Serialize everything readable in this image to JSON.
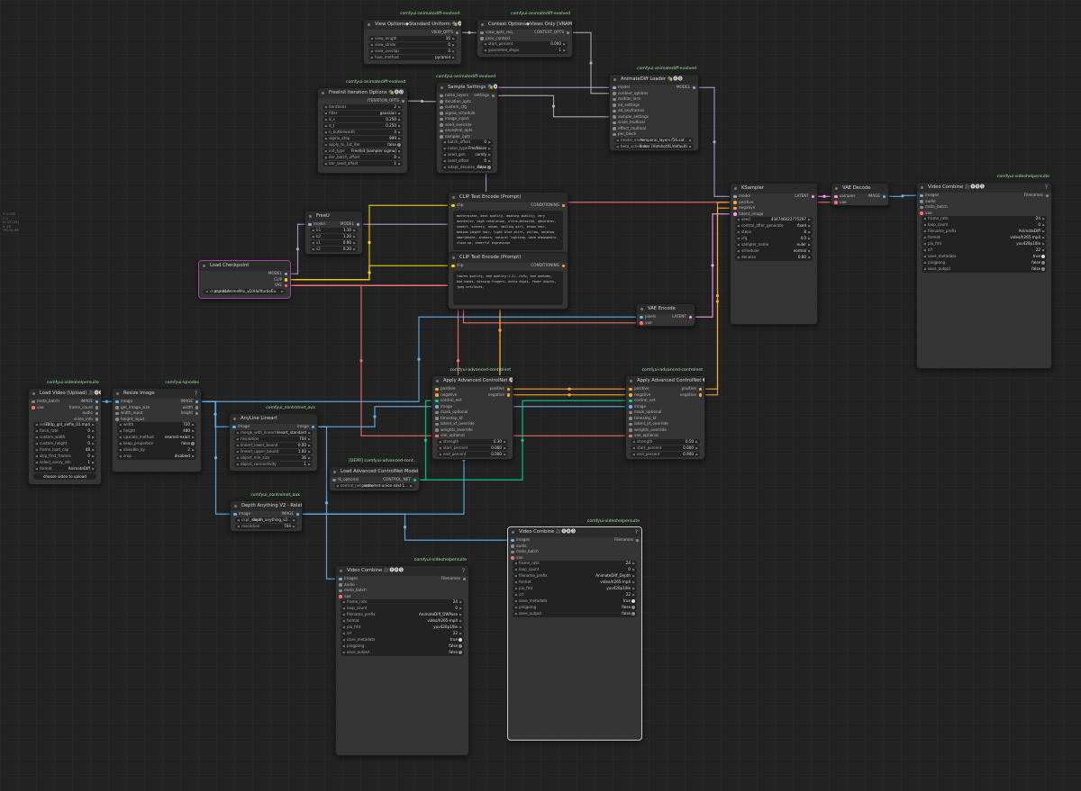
{
  "side_info": [
    "T: 0.000",
    "I: 0",
    "N: 23 [23]",
    "V: 48",
    "FPS:91.88"
  ],
  "nodes": {
    "view_options": {
      "badge": "comfyui-animatediff-evolved",
      "title": "View Options◆Standard Uniform 🎭🅐🅓",
      "outputs": [
        "VIEW_OPTS"
      ],
      "widgets": [
        {
          "label": "view_length",
          "value": "16"
        },
        {
          "label": "view_stride",
          "value": "0"
        },
        {
          "label": "view_overlap",
          "value": "4"
        },
        {
          "label": "fuse_method",
          "value": "pyramid"
        }
      ]
    },
    "context_options": {
      "badge": "comfyui-animatediff-evolved",
      "title": "Context Options◆Views Only [VRAM⇈] 🎭🅐🅓",
      "inputs": [
        "view_opts_req",
        "prev_context"
      ],
      "outputs": [
        "CONTEXT_OPTS"
      ],
      "widgets": [
        {
          "label": "start_percent",
          "value": "0.000"
        },
        {
          "label": "guarantee_steps",
          "value": "1"
        }
      ]
    },
    "freeinit": {
      "badge": "comfyui-animatediff-evolved",
      "title": "FreeInit Iteration Options 🎭🅐🅓",
      "outputs": [
        "ITERATION_OPTS"
      ],
      "widgets": [
        {
          "label": "iterations",
          "value": "2"
        },
        {
          "label": "filter",
          "value": "gaussian"
        },
        {
          "label": "d_s",
          "value": "0.250"
        },
        {
          "label": "d_t",
          "value": "0.250"
        },
        {
          "label": "n_butterworth",
          "value": "4"
        },
        {
          "label": "sigma_step",
          "value": "999"
        },
        {
          "label": "apply_to_1st_iter",
          "value": "false"
        },
        {
          "label": "init_type",
          "value": "FreeInit [sampler sigma]"
        },
        {
          "label": "iter_batch_offset",
          "value": "0"
        },
        {
          "label": "iter_seed_offset",
          "value": "1"
        }
      ]
    },
    "sample_settings": {
      "badge": "comfyui-animatediff-evolved",
      "title": "Sample Settings 🎭🅐🅓",
      "inputs": [
        "noise_layers",
        "iteration_opts",
        "custom_cfg",
        "sigma_schedule",
        "image_inject",
        "seed_override",
        "ancestral_opts",
        "sampler_opts"
      ],
      "outputs": [
        "settings"
      ],
      "widgets": [
        {
          "label": "batch_offset",
          "value": "0"
        },
        {
          "label": "noise_type",
          "value": "FreeNoise"
        },
        {
          "label": "seed_gen",
          "value": "comfy"
        },
        {
          "label": "seed_offset",
          "value": "0"
        },
        {
          "label": "adapt_denoise_steps",
          "value": "false"
        }
      ]
    },
    "ad_loader": {
      "badge": "comfyui-animatediff-evolved",
      "title": "AnimateDiff Loader 🎭🅐🅓",
      "inputs": [
        "model",
        "context_options",
        "motion_lora",
        "ad_settings",
        "ad_keyframes",
        "sample_settings",
        "scale_multival",
        "effect_multival",
        "per_block"
      ],
      "outputs": [
        "MODEL"
      ],
      "widgets": [
        {
          "label": "model_name",
          "value": "temporal_layers.f16.saf..."
        },
        {
          "label": "beta_schedule",
          "value": "linear (HotshotXL/default)"
        }
      ]
    },
    "freeu": {
      "title": "FreeU",
      "inputs": [
        "model"
      ],
      "outputs": [
        "MODEL"
      ],
      "widgets": [
        {
          "label": "b1",
          "value": "1.10"
        },
        {
          "label": "b2",
          "value": "1.20"
        },
        {
          "label": "s1",
          "value": "0.90"
        },
        {
          "label": "s2",
          "value": "0.20"
        }
      ]
    },
    "clip_pos": {
      "title": "CLIP Text Encode (Prompt)",
      "inputs": [
        "clip"
      ],
      "outputs": [
        "CONDITIONING"
      ],
      "text": "masterpiece, best quality, amazing quality, very aesthetic, high resolution, ultra-detailed, absurdres, newest, scenery, anime, smiling girl, brown hair, medium-length hair, light blue shirt, yellow, holding smartphone, indoors, natural lighting, warm atmosphere, close-up, cheerful expression"
    },
    "clip_neg": {
      "title": "CLIP Text Encode (Prompt)",
      "inputs": [
        "clip"
      ],
      "outputs": [
        "CONDITIONING"
      ],
      "text": "lowres quality, bad quality:1.2), nsfw, bad anatomy, bad hands, missing fingers, extra digit, fewer digits, jpeg artifacts,"
    },
    "checkpoint": {
      "title": "Load Checkpoint",
      "outputs": [
        "MODEL",
        "CLIP",
        "VAE"
      ],
      "widgets": [
        {
          "label": "ckpt_name",
          "value": "aamXLAnimeMix_v10HalfturboEu..."
        }
      ]
    },
    "ksampler": {
      "title": "KSampler",
      "inputs": [
        "model",
        "positive",
        "negative",
        "latent_image"
      ],
      "outputs": [
        "LATENT"
      ],
      "widgets": [
        {
          "label": "seed",
          "value": "434746022775297"
        },
        {
          "label": "control_after_generate",
          "value": "fixed"
        },
        {
          "label": "steps",
          "value": "8"
        },
        {
          "label": "cfg",
          "value": "4.0"
        },
        {
          "label": "sampler_name",
          "value": "euler"
        },
        {
          "label": "scheduler",
          "value": "normal"
        },
        {
          "label": "denoise",
          "value": "0.80"
        }
      ]
    },
    "vae_decode": {
      "title": "VAE Decode",
      "inputs": [
        "samples",
        "vae"
      ],
      "outputs": [
        "IMAGE"
      ]
    },
    "vc_main": {
      "badge": "comfyui-videohelpersuite",
      "title": "Video Combine 🎥🅥🅗🅢",
      "inputs": [
        "images",
        "audio",
        "meta_batch",
        "vae"
      ],
      "outputs": [
        "Filenames"
      ],
      "widgets": [
        {
          "label": "frame_rate",
          "value": "24"
        },
        {
          "label": "loop_count",
          "value": "0"
        },
        {
          "label": "filename_prefix",
          "value": "AnimateDiff"
        },
        {
          "label": "format",
          "value": "video/h265-mp4"
        },
        {
          "label": "pix_fmt",
          "value": "yuv420p10le"
        },
        {
          "label": "crf",
          "value": "22"
        },
        {
          "label": "save_metadata",
          "value": "true"
        },
        {
          "label": "pingpong",
          "value": "false"
        },
        {
          "label": "save_output",
          "value": "false"
        }
      ]
    },
    "vae_encode": {
      "title": "VAE Encode",
      "inputs": [
        "pixels",
        "vae"
      ],
      "outputs": [
        "LATENT"
      ]
    },
    "load_video": {
      "badge": "comfyui-videohelpersuite",
      "title": "Load Video (Upload) 🎥🅥🅗🅢",
      "inputs": [
        "meta_batch",
        "vae"
      ],
      "outputs": [
        "IMAGE",
        "frame_count",
        "audio",
        "video_info"
      ],
      "widgets": [
        {
          "label": "video",
          "value": "720p_girl_selfie_01.mp4"
        },
        {
          "label": "force_rate",
          "value": "0"
        },
        {
          "label": "custom_width",
          "value": "0"
        },
        {
          "label": "custom_height",
          "value": "0"
        },
        {
          "label": "frame_load_cap",
          "value": "48"
        },
        {
          "label": "skip_first_frames",
          "value": "0"
        },
        {
          "label": "select_every_nth",
          "value": "1"
        },
        {
          "label": "format",
          "value": "AnimateDiff"
        }
      ],
      "button": "choose video to upload"
    },
    "resize": {
      "badge": "comfyui-kjnodes",
      "title": "Resize Image",
      "inputs": [
        "image",
        "get_image_size",
        "width_input",
        "height_input"
      ],
      "outputs": [
        "IMAGE",
        "width",
        "height"
      ],
      "widgets": [
        {
          "label": "width",
          "value": "720"
        },
        {
          "label": "height",
          "value": "480"
        },
        {
          "label": "upscale_method",
          "value": "nearest-exact"
        },
        {
          "label": "keep_proportion",
          "value": "false"
        },
        {
          "label": "divisible_by",
          "value": "2"
        },
        {
          "label": "crop",
          "value": "disabled"
        }
      ]
    },
    "anyline": {
      "badge": "comfyui_controlnet_aux",
      "title": "AnyLine Lineart",
      "inputs": [
        "image"
      ],
      "outputs": [
        "image"
      ],
      "widgets": [
        {
          "label": "merge_with_lineart",
          "value": "lineart_standard"
        },
        {
          "label": "resolution",
          "value": "704"
        },
        {
          "label": "lineart_lower_bound",
          "value": "0.00"
        },
        {
          "label": "lineart_upper_bound",
          "value": "1.00"
        },
        {
          "label": "object_min_size",
          "value": "36"
        },
        {
          "label": "object_connectivity",
          "value": "1"
        }
      ]
    },
    "acn1": {
      "badge": "comfyui-advanced-controlnet",
      "title": "Apply Advanced ControlNet 🅐🅒🅝",
      "inputs": [
        "positive",
        "negative",
        "control_net",
        "image",
        "mask_optional",
        "timestep_kf",
        "latent_kf_override",
        "weights_override",
        "vae_optional"
      ],
      "outputs": [
        "positive",
        "negative"
      ],
      "widgets": [
        {
          "label": "strength",
          "value": "0.30"
        },
        {
          "label": "start_percent",
          "value": "0.000"
        },
        {
          "label": "end_percent",
          "value": "0.000"
        }
      ]
    },
    "acn2": {
      "badge": "comfyui-advanced-controlnet",
      "title": "Apply Advanced ControlNet 🅐🅒🅝",
      "inputs": [
        "positive",
        "negative",
        "control_net",
        "image",
        "mask_optional",
        "timestep_kf",
        "latent_kf_override",
        "weights_override",
        "vae_optional"
      ],
      "outputs": [
        "positive",
        "negative"
      ],
      "widgets": [
        {
          "label": "strength",
          "value": "0.50"
        },
        {
          "label": "start_percent",
          "value": "0.000"
        },
        {
          "label": "end_percent",
          "value": "0.900"
        }
      ]
    },
    "load_cn": {
      "badge": "[DEPR] comfyui-advanced-cont...",
      "title": "Load Advanced ControlNet Model 🅐🅒🅝",
      "inputs": [
        "tk_optional"
      ],
      "outputs": [
        "CONTROL_NET"
      ],
      "widgets": [
        {
          "label": "control_net_name",
          "value": "controlnet-union-sdxl-1..."
        }
      ]
    },
    "depth": {
      "badge": "comfyui_controlnet_aux",
      "title": "Depth Anything V2 - Relative",
      "inputs": [
        "image"
      ],
      "outputs": [
        "IMAGE"
      ],
      "widgets": [
        {
          "label": "ckpt_name",
          "value": "depth_anything_v2..."
        },
        {
          "label": "resolution",
          "value": "704"
        }
      ]
    },
    "vc_depth": {
      "badge": "comfyui-videohelpersuite",
      "title": "Video Combine 🎥🅥🅗🅢",
      "inputs": [
        "images",
        "audio",
        "meta_batch",
        "vae"
      ],
      "outputs": [
        "Filenames"
      ],
      "widgets": [
        {
          "label": "frame_rate",
          "value": "24"
        },
        {
          "label": "loop_count",
          "value": "0"
        },
        {
          "label": "filename_prefix",
          "value": "AnimateDiff_Depth"
        },
        {
          "label": "format",
          "value": "video/h265-mp4"
        },
        {
          "label": "pix_fmt",
          "value": "yuv420p10le"
        },
        {
          "label": "crf",
          "value": "22"
        },
        {
          "label": "save_metadata",
          "value": "true"
        },
        {
          "label": "pingpong",
          "value": "false"
        },
        {
          "label": "save_output",
          "value": "false"
        }
      ]
    },
    "vc_pose": {
      "badge": "comfyui-videohelpersuite",
      "title": "Video Combine 🎥🅥🅗🅢",
      "inputs": [
        "images",
        "audio",
        "meta_batch",
        "vae"
      ],
      "outputs": [
        "Filenames"
      ],
      "widgets": [
        {
          "label": "frame_rate",
          "value": "24"
        },
        {
          "label": "loop_count",
          "value": "0"
        },
        {
          "label": "filename_prefix",
          "value": "AnimateDiff_DWPose"
        },
        {
          "label": "format",
          "value": "video/h265-mp4"
        },
        {
          "label": "pix_fmt",
          "value": "yuv420p10le"
        },
        {
          "label": "crf",
          "value": "22"
        },
        {
          "label": "save_metadata",
          "value": "true"
        },
        {
          "label": "pingpong",
          "value": "false"
        },
        {
          "label": "save_output",
          "value": "false"
        }
      ]
    }
  },
  "type_colors": {
    "MODEL": "#b39ddb",
    "CLIP": "#ffd500",
    "VAE": "#ff6e6e",
    "CONDITIONING": "#ffa931",
    "LATENT": "#ff9cf9",
    "IMAGE": "#64b5f6",
    "CONTROL_NET": "#00d78d",
    "OTHER": "#b0b0b0"
  }
}
